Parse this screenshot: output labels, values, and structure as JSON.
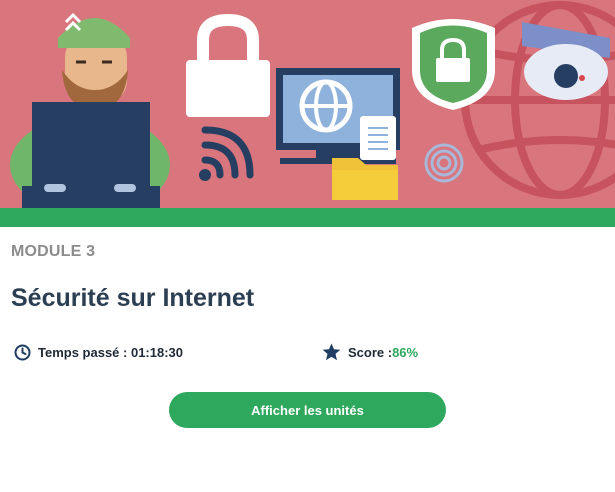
{
  "module": {
    "label": "MODULE 3",
    "title": "Sécurité sur Internet"
  },
  "stats": {
    "time_label": "Temps passé : 01:18:30",
    "score_label": "Score : ",
    "score_value": "86%"
  },
  "actions": {
    "view_units_label": "Afficher les unités"
  },
  "colors": {
    "banner_bg": "#d9757c",
    "accent_green": "#2ea85d",
    "title_dark": "#2b3e52"
  },
  "icons": {
    "time": "clock-icon",
    "score": "star-icon"
  }
}
